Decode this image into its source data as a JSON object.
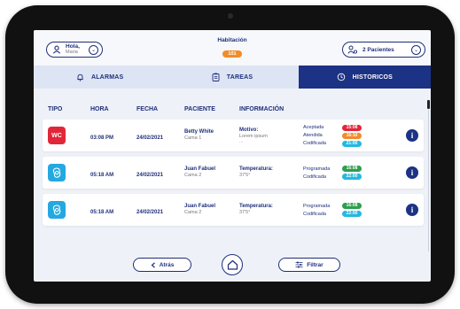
{
  "header": {
    "greeting": "Hola,",
    "user_name": "Maria",
    "room_label": "Habitación",
    "room_number": "101",
    "patients_label": "2 Pacientes"
  },
  "tabs": [
    {
      "label": "ALARMAS",
      "icon": "bell-icon",
      "active": false
    },
    {
      "label": "TAREAS",
      "icon": "clipboard-icon",
      "active": false
    },
    {
      "label": "HISTORICOS",
      "icon": "history-icon",
      "active": true
    }
  ],
  "table": {
    "headers": [
      "TIPO",
      "HORA",
      "FECHA",
      "PACIENTE",
      "INFORMACIÓN"
    ],
    "rows": [
      {
        "type": "WC",
        "type_color": "#e2263a",
        "hora": "03:08 PM",
        "fecha": "24/02/2021",
        "paciente": "Betty White",
        "cama": "Cama 1",
        "info_title": "Motivo:",
        "info_value": "Lorem ipsum",
        "info_extra": "...",
        "statuses": [
          {
            "label": "Aceptada",
            "time": "15:08",
            "color": "#e2263a"
          },
          {
            "label": "Atendida",
            "time": "16:10",
            "color": "#f28c28"
          },
          {
            "label": "Codificada",
            "time": "21:00",
            "color": "#24b8e0"
          }
        ]
      },
      {
        "type": "thermometer-icon",
        "type_color": "#24a8e0",
        "hora": "05:18 AM",
        "fecha": "24/02/2021",
        "paciente": "Juan Fabuel",
        "cama": "Cama 2",
        "info_title": "Temperatura:",
        "info_value": "37'5°",
        "info_extra": "",
        "statuses": [
          {
            "label": "Programada",
            "time": "16:08",
            "color": "#2e9e4f"
          },
          {
            "label": "Codificada",
            "time": "22:00",
            "color": "#24b8e0"
          }
        ]
      },
      {
        "type": "thermometer-icon",
        "type_color": "#24a8e0",
        "hora": "05:18 AM",
        "fecha": "24/02/2021",
        "paciente": "Juan Fabuel",
        "cama": "Cama 2",
        "info_title": "Temperatura:",
        "info_value": "37'5°",
        "info_extra": "",
        "statuses": [
          {
            "label": "Programada",
            "time": "16:08",
            "color": "#2e9e4f"
          },
          {
            "label": "Codificada",
            "time": "22:00",
            "color": "#24b8e0"
          }
        ]
      }
    ]
  },
  "footer": {
    "back_label": "Atrás",
    "filter_label": "Filtrar"
  },
  "colors": {
    "primary": "#1c3284",
    "accent_orange": "#f28c28",
    "danger": "#e2263a",
    "success": "#2e9e4f",
    "info": "#24b8e0"
  }
}
